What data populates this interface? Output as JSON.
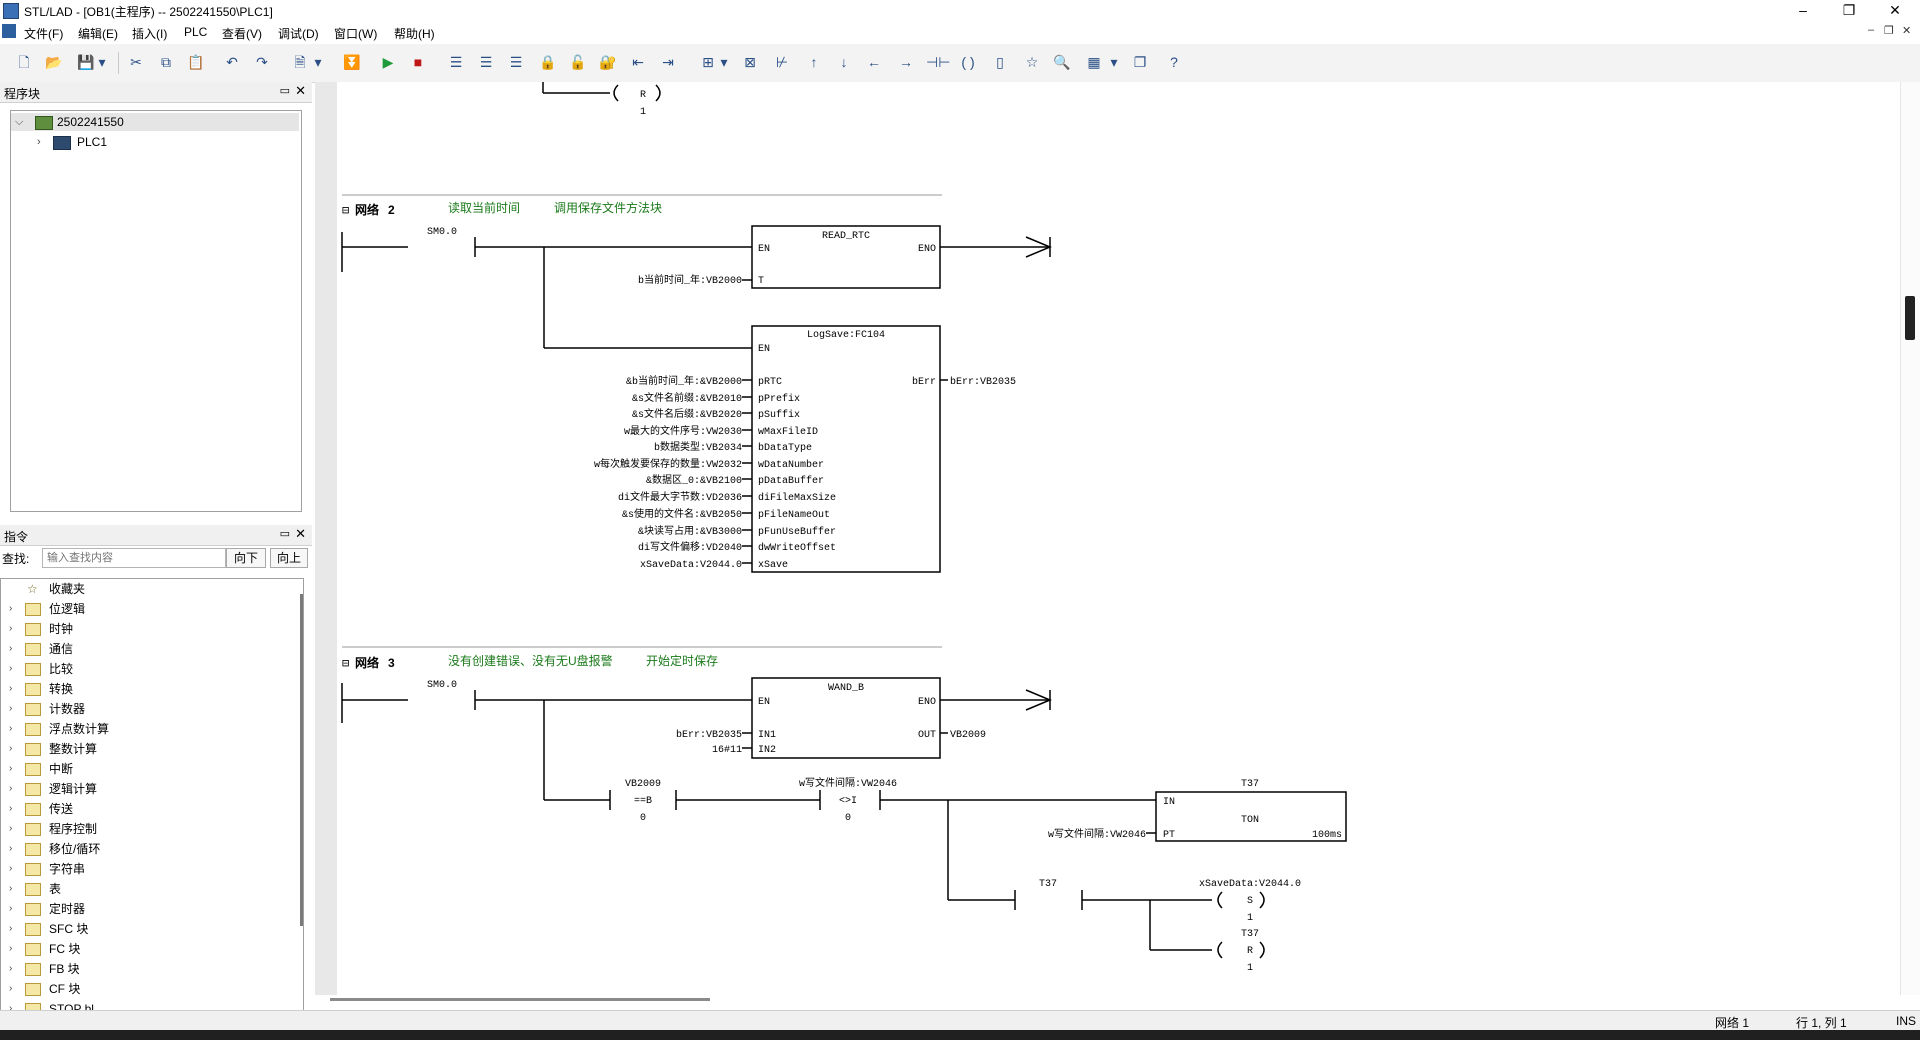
{
  "window": {
    "title": "STL/LAD - [OB1(主程序) -- 2502241550\\PLC1]",
    "minimize": "–",
    "restore": "❐",
    "close": "✕"
  },
  "menu": {
    "items": [
      "文件(F)",
      "编辑(E)",
      "插入(I)",
      "PLC",
      "查看(V)",
      "调试(D)",
      "窗口(W)",
      "帮助(H)"
    ],
    "mdi_min": "–",
    "mdi_restore": "❐",
    "mdi_close": "✕"
  },
  "program_panel": {
    "title": "程序块",
    "root": "2502241550",
    "child": "PLC1"
  },
  "instruction_panel": {
    "title": "指令",
    "search_label": "查找:",
    "search_placeholder": "输入查找内容",
    "down_button": "向下",
    "up_button": "向上",
    "items": [
      "收藏夹",
      "位逻辑",
      "时钟",
      "通信",
      "比较",
      "转换",
      "计数器",
      "浮点数计算",
      "整数计算",
      "中断",
      "逻辑计算",
      "传送",
      "程序控制",
      "移位/循环",
      "字符串",
      "表",
      "定时器",
      "SFC 块",
      "FC 块",
      "FB 块",
      "CF 块",
      "STOP bl..."
    ]
  },
  "editor": {
    "net1_tail": {
      "coil": "R",
      "value": "1"
    },
    "network2": {
      "label": "网络",
      "number": "2",
      "comment1": "读取当前时间",
      "comment2": "调用保存文件方法块",
      "contact": "SM0.0",
      "block1": {
        "name": "READ_RTC",
        "en": "EN",
        "eno": "ENO",
        "pin_t": "T",
        "param_t": "b当前时间_年:VB2000"
      },
      "block2": {
        "name": "LogSave:FC104",
        "en": "EN",
        "out_pin": "bErr",
        "out_param": "bErr:VB2035",
        "pins": [
          "pRTC",
          "pPrefix",
          "pSuffix",
          "wMaxFileID",
          "bDataType",
          "wDataNumber",
          "pDataBuffer",
          "diFileMaxSize",
          "pFileNameOut",
          "pFunUseBuffer",
          "dwWriteOffset",
          "xSave"
        ],
        "params": [
          "&b当前时间_年:&VB2000",
          "&s文件名前缀:&VB2010",
          "&s文件名后缀:&VB2020",
          "w最大的文件序号:VW2030",
          "b数据类型:VB2034",
          "w每次触发要保存的数量:VW2032",
          "&数据区_0:&VB2100",
          "di文件最大字节数:VD2036",
          "&s使用的文件名:&VB2050",
          "&块读写占用:&VB3000",
          "di写文件偏移:VD2040",
          "xSaveData:V2044.0"
        ]
      }
    },
    "network3": {
      "label": "网络",
      "number": "3",
      "comment1": "没有创建错误、没有无U盘报警",
      "comment2": "开始定时保存",
      "contact": "SM0.0",
      "wand": {
        "name": "WAND_B",
        "en": "EN",
        "eno": "ENO",
        "in1": "IN1",
        "in2": "IN2",
        "out": "OUT",
        "in1_param": "bErr:VB2035",
        "in2_param": "16#11",
        "out_param": "VB2009"
      },
      "cmp1": {
        "top": "VB2009",
        "op": "==B",
        "bottom": "0"
      },
      "cmp2": {
        "top": "w写文件间隔:VW2046",
        "op": "<>I",
        "bottom": "0"
      },
      "timer": {
        "name": "T37",
        "type": "TON",
        "in": "IN",
        "pt": "PT",
        "pt_param": "w写文件间隔:VW2046",
        "base": "100ms"
      },
      "contact2": "T37",
      "coil_s": {
        "name": "xSaveData:V2044.0",
        "op": "S",
        "value": "1"
      },
      "coil_r": {
        "name": "T37",
        "op": "R",
        "value": "1"
      }
    }
  },
  "status": {
    "network": "网络 1",
    "position": "行 1, 列 1",
    "mode": "INS"
  }
}
